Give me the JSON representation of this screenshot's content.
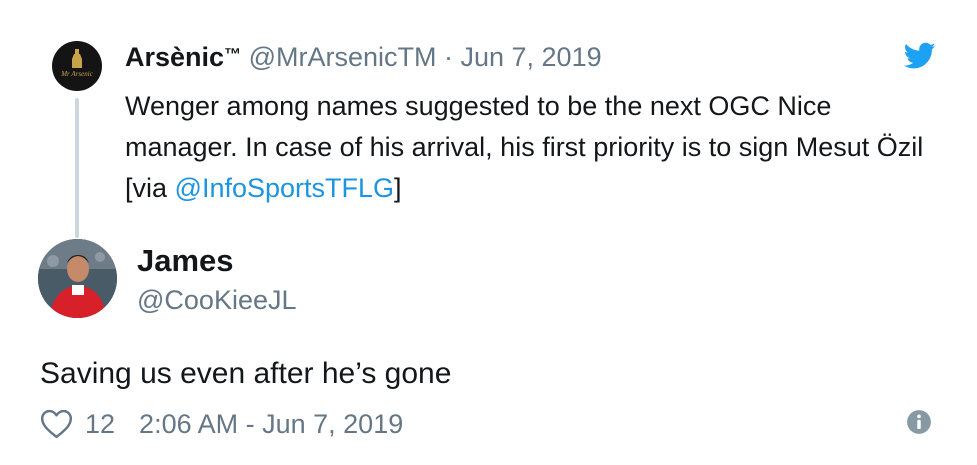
{
  "parent_tweet": {
    "author_name": "Arsènic",
    "trademark": "™",
    "handle": "@MrArsenicTM",
    "separator": " · ",
    "date": "Jun 7, 2019",
    "avatar_logo_text": "Mr Arsenic",
    "text_before_link": "Wenger among names suggested to be the next OGC Nice manager. In case of his arrival, his first priority is to sign Mesut Özil [via ",
    "link_text": "@InfoSportsTFLG",
    "text_after_link": "]"
  },
  "reply_tweet": {
    "author_name": "James",
    "handle": "@CooKieeJL",
    "text": "Saving us even after he’s gone",
    "like_count": "12",
    "timestamp": "2:06 AM - Jun 7, 2019"
  },
  "icons": {
    "brand": "twitter-bird-icon",
    "like": "heart-icon",
    "info": "info-icon"
  },
  "colors": {
    "link": "#1b95e0",
    "muted": "#657786",
    "text": "#14171a",
    "thread_line": "#ccd6dd"
  }
}
